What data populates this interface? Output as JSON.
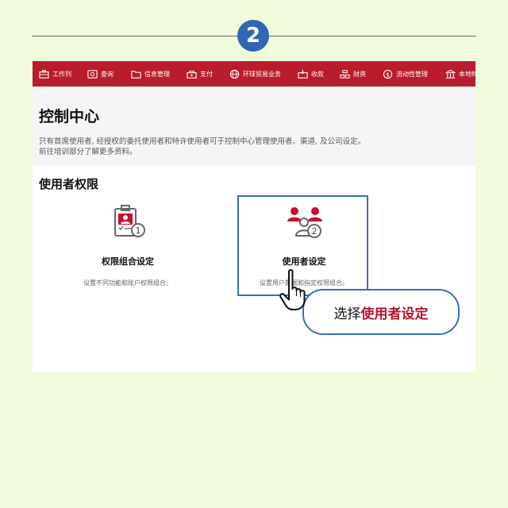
{
  "step_number": "2",
  "nav": {
    "items": [
      {
        "label": "工作列",
        "icon": "briefcase-icon"
      },
      {
        "label": "查询",
        "icon": "search-card-icon"
      },
      {
        "label": "信息管理",
        "icon": "folder-icon"
      },
      {
        "label": "支付",
        "icon": "payment-icon"
      },
      {
        "label": "环球贸易业务",
        "icon": "globe-icon"
      },
      {
        "label": "收款",
        "icon": "receive-icon"
      },
      {
        "label": "财资",
        "icon": "treasury-icon"
      },
      {
        "label": "流动性管理",
        "icon": "dollar-circle-icon"
      },
      {
        "label": "本地特",
        "icon": "bank-building-icon"
      }
    ]
  },
  "page": {
    "title": "控制中心",
    "description_line1": "只有首席使用者, 经授权的委托使用者和特许使用者可于控制中心管理使用者、渠道, 及公司设定。",
    "description_line2": "前往培训部分了解更多资料。"
  },
  "section": {
    "title": "使用者权限",
    "cards": [
      {
        "title": "权限组合设定",
        "description": "设置不同功能和账户权限组合。",
        "icon": "permission-badge-icon"
      },
      {
        "title": "使用者设定",
        "description": "设置用户数据和指定权限组合。",
        "icon": "users-group-icon"
      }
    ]
  },
  "callout": {
    "prefix": "选择",
    "emphasis": "使用者设定"
  },
  "colors": {
    "nav_red": "#b91c2c",
    "highlight_blue": "#3b6cb8",
    "emphasis_red": "#b8122f",
    "background": "#f0fbdc"
  }
}
